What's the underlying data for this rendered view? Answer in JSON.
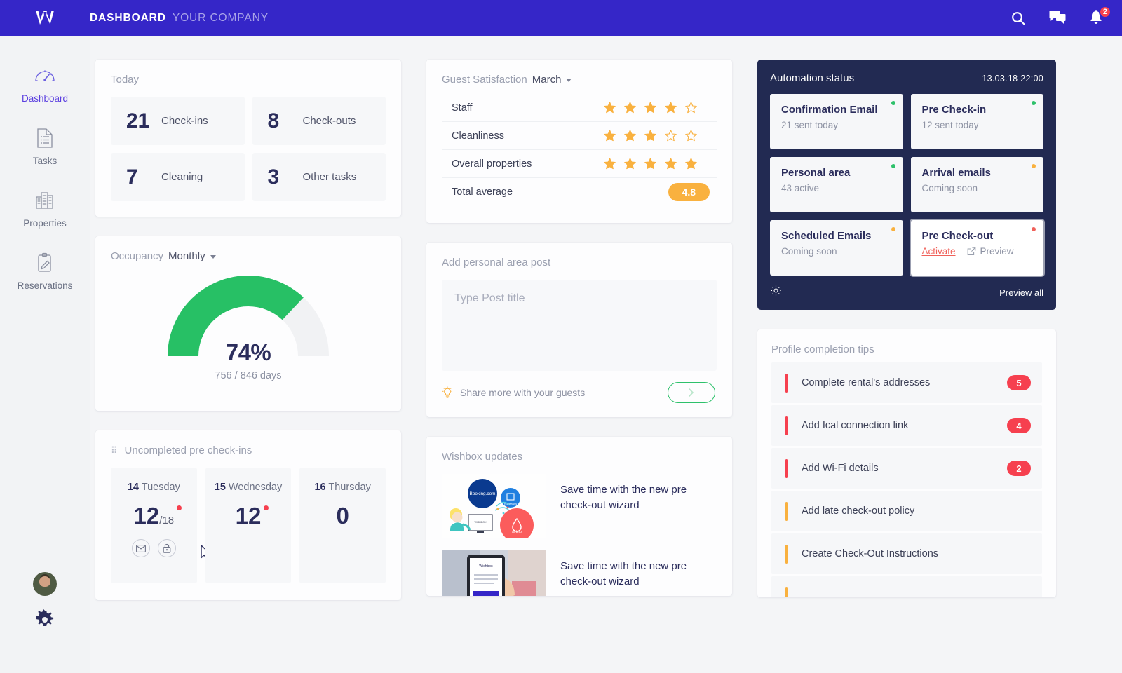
{
  "topbar": {
    "logo": "W",
    "title": "DASHBOARD",
    "subtitle": "YOUR COMPANY",
    "icons": [
      "search-icon",
      "chat-icon",
      "bell-icon"
    ],
    "notification_count": "2",
    "bg_color": "#3526c8"
  },
  "sidebar": {
    "items": [
      {
        "label": "Dashboard",
        "icon": "speedometer-icon",
        "active": true
      },
      {
        "label": "Tasks",
        "icon": "document-list-icon",
        "active": false
      },
      {
        "label": "Properties",
        "icon": "buildings-icon",
        "active": false
      },
      {
        "label": "Reservations",
        "icon": "clipboard-pencil-icon",
        "active": false
      }
    ],
    "avatar": "user-avatar",
    "settings_icon": "gear-icon"
  },
  "today": {
    "title": "Today",
    "tiles": [
      {
        "value": "21",
        "label": "Check-ins"
      },
      {
        "value": "8",
        "label": "Check-outs"
      },
      {
        "value": "7",
        "label": "Cleaning"
      },
      {
        "value": "3",
        "label": "Other tasks"
      }
    ]
  },
  "occupancy": {
    "label": "Occupancy",
    "period": "Monthly",
    "percent_text": "74%",
    "percent_value": 74,
    "detail": "756 / 846 days",
    "arc_color": "#27c065"
  },
  "uncompleted": {
    "title": "Uncompleted pre check-ins",
    "days": [
      {
        "date": "14",
        "weekday": "Tuesday",
        "count": "12",
        "denominator": "/18",
        "alert": true,
        "actions": [
          "mail-icon",
          "lock-icon"
        ]
      },
      {
        "date": "15",
        "weekday": "Wednesday",
        "count": "12",
        "denominator": "",
        "alert": true,
        "actions": []
      },
      {
        "date": "16",
        "weekday": "Thursday",
        "count": "0",
        "denominator": "",
        "alert": false,
        "actions": []
      }
    ]
  },
  "guest_satisfaction": {
    "label": "Guest Satisfaction",
    "period": "March",
    "rows": [
      {
        "name": "Staff",
        "stars": 4
      },
      {
        "name": "Cleanliness",
        "stars": 3
      },
      {
        "name": "Overall properties",
        "stars": 5
      }
    ],
    "total_label": "Total average",
    "total_value": "4.8",
    "star_color": "#f9b13f"
  },
  "add_post": {
    "title": "Add personal area post",
    "placeholder": "Type Post title",
    "hint": "Share more with your guests",
    "hint_icon": "lightbulb-icon",
    "submit_icon": "chevron-right-icon"
  },
  "wishbox": {
    "title": "Wishbox updates",
    "items": [
      {
        "text": "Save time with the new pre check-out wizard",
        "thumb": "booking-airbnb-illustration"
      },
      {
        "text": "Save time with the new pre check-out wizard",
        "thumb": "phone-in-hand-photo"
      }
    ]
  },
  "automation": {
    "title": "Automation status",
    "timestamp": "13.03.18  22:00",
    "settings_icon": "gear-icon",
    "preview_all": "Preview all",
    "cards": [
      {
        "title": "Confirmation Email",
        "subtitle": "21 sent today",
        "dot": "#2ec16b",
        "highlight": false
      },
      {
        "title": "Pre Check-in",
        "subtitle": "12 sent today",
        "dot": "#2ec16b",
        "highlight": false
      },
      {
        "title": "Personal area",
        "subtitle": "43 active",
        "dot": "#2ec16b",
        "highlight": false
      },
      {
        "title": "Arrival emails",
        "subtitle": "Coming soon",
        "dot": "#f9b13f",
        "highlight": false
      },
      {
        "title": "Scheduled Emails",
        "subtitle": "Coming soon",
        "dot": "#f9b13f",
        "highlight": false
      },
      {
        "title": "Pre Check-out",
        "subtitle": "",
        "activate": "Activate",
        "preview": "Preview",
        "dot": "#f0615a",
        "highlight": true
      }
    ]
  },
  "profile_tips": {
    "title": "Profile completion tips",
    "items": [
      {
        "label": "Complete rental's addresses",
        "badge": "5",
        "bar": "#f6404f"
      },
      {
        "label": "Add Ical connection link",
        "badge": "4",
        "bar": "#f6404f"
      },
      {
        "label": "Add Wi-Fi details",
        "badge": "2",
        "bar": "#f6404f"
      },
      {
        "label": "Add late check-out policy",
        "badge": "",
        "bar": "#f9b13f"
      },
      {
        "label": "Create Check-Out Instructions",
        "badge": "",
        "bar": "#f9b13f"
      },
      {
        "label": "",
        "badge": "",
        "bar": "#f9b13f"
      }
    ]
  }
}
